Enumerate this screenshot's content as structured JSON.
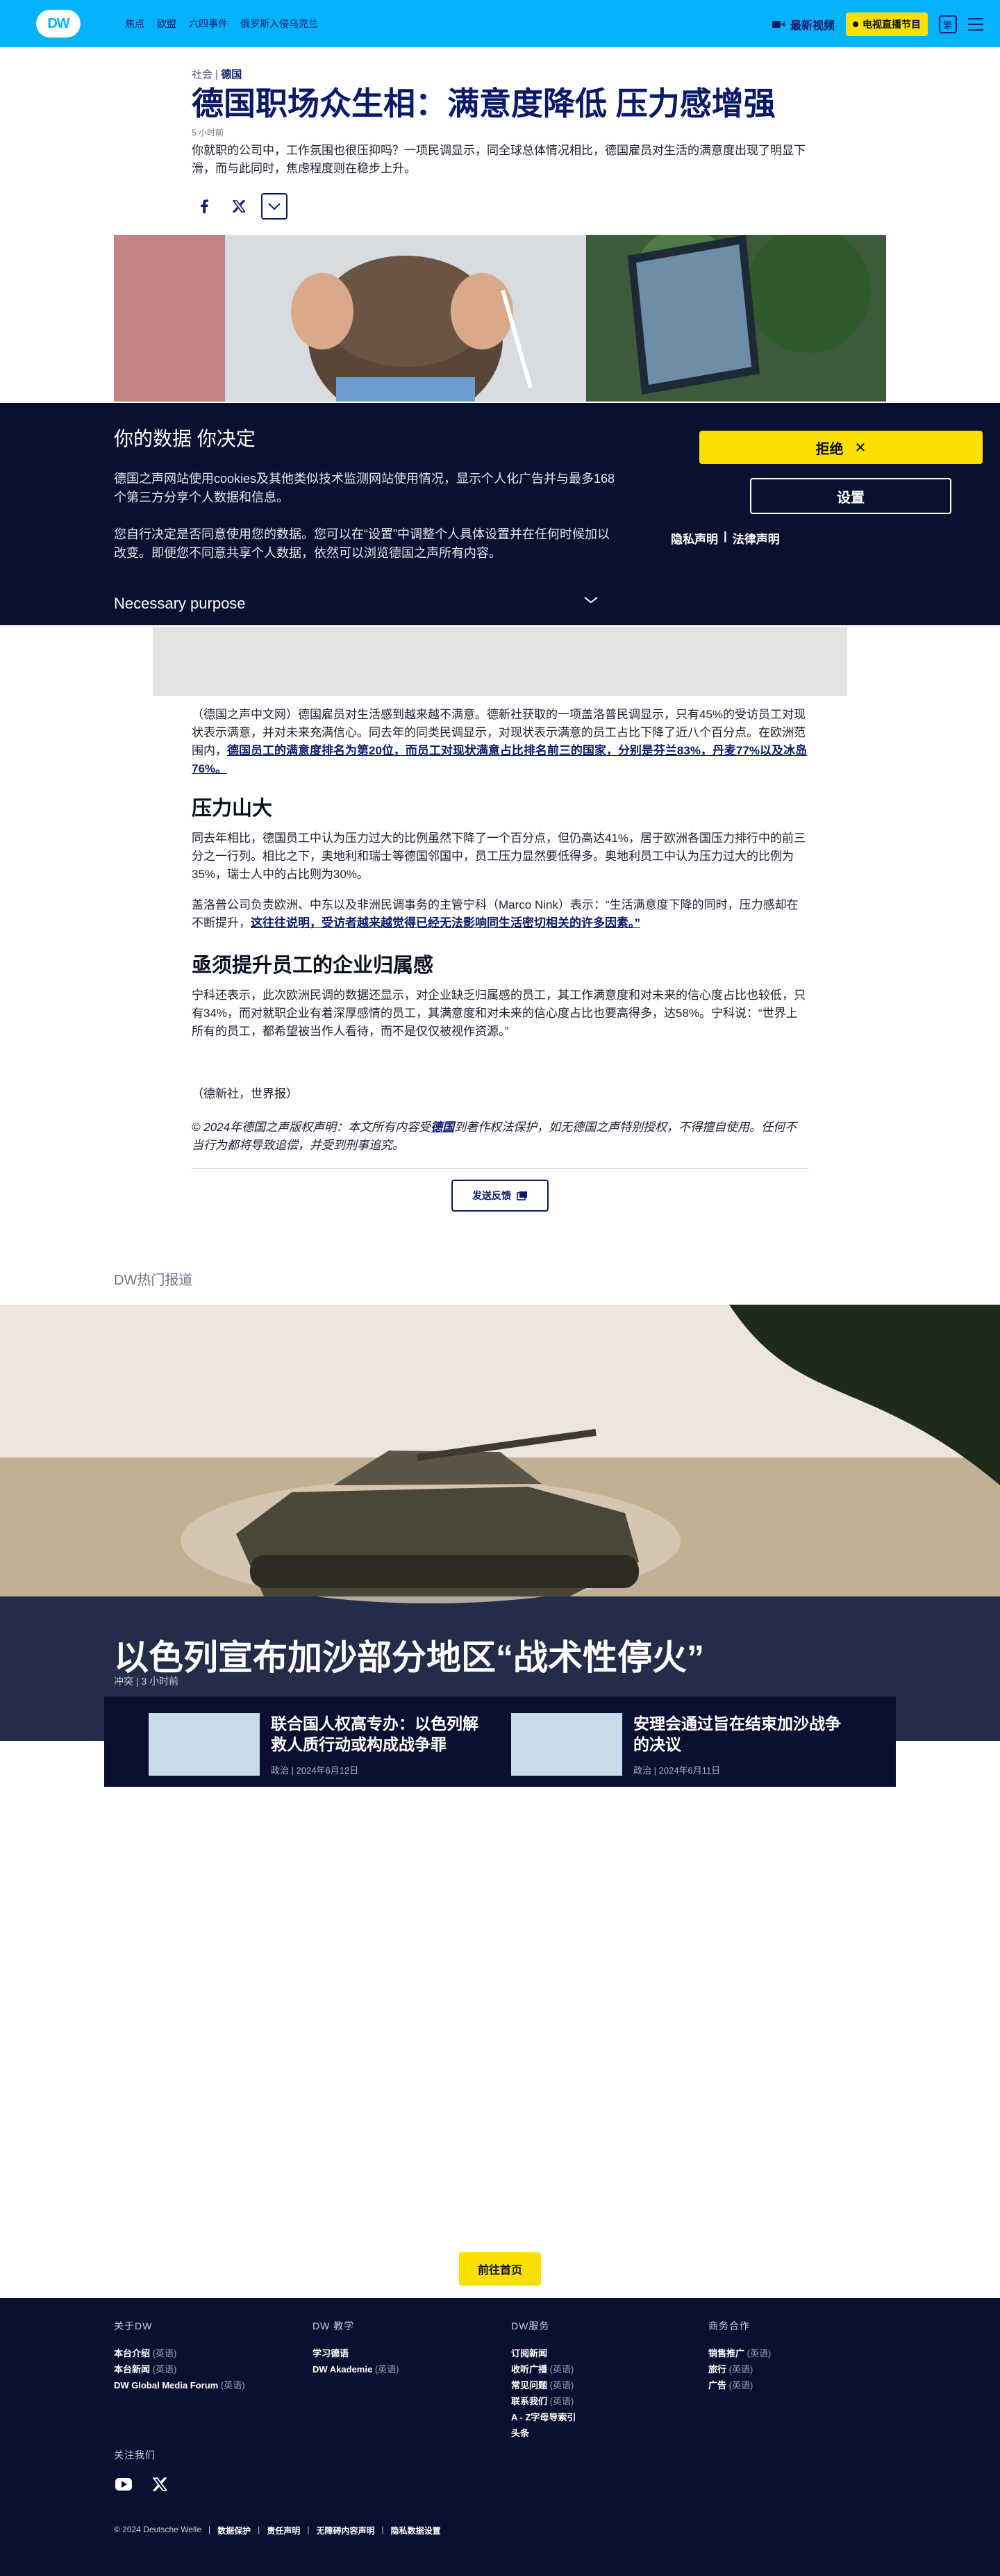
{
  "header": {
    "logo_text": "DW",
    "nav": [
      "焦点",
      "欧盟",
      "六四事件",
      "俄罗斯入侵乌克兰"
    ],
    "video_label": "最新视频",
    "tv_label": "电视直播节目",
    "lang_label": "繁"
  },
  "article": {
    "category": "社会",
    "tag": "德国",
    "title": "德国职场众生相：满意度降低 压力感增强",
    "time": "5 小时前",
    "teaser": "你就职的公司中，工作氛围也很压抑吗？一项民调显示，同全球总体情况相比，德国雇员对生活的满意度出现了明显下滑，而与此同时，焦虑程度则在稳步上升。",
    "p1_a": "（德国之声中文网）德国雇员对生活感到越来越不满意。德新社获取的一项盖洛普民调显示，只有45%的受访员工对现状表示满意，并对未来充满信心。同去年的同类民调显示，对现状表示满意的员工占比下降了近八个百分点。在欧洲范围内，",
    "p1_link": "德国员工的满意度排名为第20位，而员工对现状满意占比排名前三的国家，分别是芬兰83%，丹麦77%以及冰岛76%。",
    "h2_1": "压力山大",
    "p2": "同去年相比，德国员工中认为压力过大的比例虽然下降了一个百分点，但仍高达41%，居于欧洲各国压力排行中的前三分之一行列。相比之下，奥地利和瑞士等德国邻国中，员工压力显然要低得多。奥地利员工中认为压力过大的比例为35%，瑞士人中的占比则为30%。",
    "p3_a": "盖洛普公司负责欧洲、中东以及非洲民调事务的主管宁科（Marco Nink）表示：“生活满意度下降的同时，压力感却在不断提升，",
    "p3_link": "这往往说明，受访者越来越觉得已经无法影响同生活密切相关的许多因素。”",
    "h2_2": "亟须提升员工的企业归属感",
    "p4": "宁科还表示，此次欧洲民调的数据还显示，对企业缺乏归属感的员工，其工作满意度和对未来的信心度占比也较低，只有34%，而对就职企业有着深厚感情的员工，其满意度和对未来的信心度占比也要高得多，达58%。宁科说：“世界上所有的员工，都希望被当作人看待，而不是仅仅被视作资源。”",
    "source": "（德新社，世界报）",
    "copyright_a": "© 2024年德国之声版权声明：本文所有内容受",
    "copyright_link": "德国",
    "copyright_b": "到著作权法保护，如无德国之声特别授权，不得擅自使用。任何不当行为都将导致追偿，并受到刑事追究。",
    "feedback_label": "发送反馈"
  },
  "cookie": {
    "title": "你的数据 你决定",
    "text1": "德国之声网站使用cookies及其他类似技术监测网站使用情况，显示个人化广告并与最多168 个第三方分享个人数据和信息。",
    "text2": "您自行决定是否同意使用您的数据。您可以在“设置”中调整个人具体设置并在任何时候加以改变。即便您不同意共享个人数据，依然可以浏览德国之声所有内容。",
    "purpose_label": "Necessary purpose",
    "reject_label": "拒绝",
    "settings_label": "设置",
    "privacy_label": "隐私声明",
    "legal_label": "法律声明"
  },
  "hot": {
    "section_label": "DW热门报道",
    "main_title": "以色列宣布加沙部分地区“战术性停火”",
    "main_category": "冲突",
    "main_time": "3 小时前",
    "cards": [
      {
        "title": "联合国人权高专办：以色列解救人质行动或构成战争罪",
        "category": "政治",
        "date": "2024年6月12日"
      },
      {
        "title": "安理会通过旨在结束加沙战争的决议",
        "category": "政治",
        "date": "2024年6月11日"
      }
    ]
  },
  "home_label": "前往首页",
  "footer": {
    "cols": [
      {
        "title": "关于DW",
        "items": [
          {
            "label": "本台介绍",
            "sub": "(英语)"
          },
          {
            "label": "本台新闻",
            "sub": "(英语)"
          },
          {
            "label": "DW Global Media Forum",
            "sub": "(英语)"
          }
        ]
      },
      {
        "title": "DW 教学",
        "items": [
          {
            "label": "学习德语",
            "sub": ""
          },
          {
            "label": "DW Akademie",
            "sub": "(英语)"
          }
        ]
      },
      {
        "title": "DW服务",
        "items": [
          {
            "label": "订阅新闻",
            "sub": ""
          },
          {
            "label": "收听广播",
            "sub": "(英语)"
          },
          {
            "label": "常见问题",
            "sub": "(英语)"
          },
          {
            "label": "联系我们",
            "sub": "(英语)"
          },
          {
            "label": "A - Z字母导索引",
            "sub": ""
          },
          {
            "label": "头条",
            "sub": ""
          }
        ]
      },
      {
        "title": "商务合作",
        "items": [
          {
            "label": "销售推广",
            "sub": "(英语)"
          },
          {
            "label": "旅行",
            "sub": "(英语)"
          },
          {
            "label": "广告",
            "sub": "(英语)"
          }
        ]
      }
    ],
    "follow_label": "关注我们",
    "copyright": "© 2024 Deutsche Welle",
    "legal_links": [
      "数据保护",
      "责任声明",
      "无障碍内容声明",
      "隐私数据设置"
    ]
  },
  "colors": {
    "brand": "#05b2fc",
    "navy": "#0a1030",
    "accent_yellow": "#fae000",
    "title_blue": "#0a1a6b"
  }
}
